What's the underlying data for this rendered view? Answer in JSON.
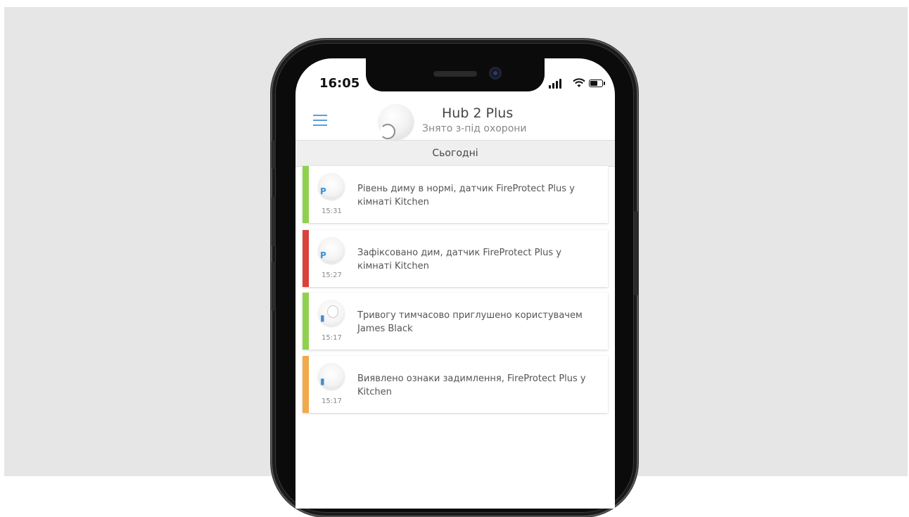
{
  "status_bar": {
    "time": "16:05"
  },
  "header": {
    "hub_name": "Hub 2 Plus",
    "hub_status": "Знято з-під охорони"
  },
  "section": {
    "title": "Сьогодні"
  },
  "events": [
    {
      "time": "15:31",
      "text": "Рівень диму в нормі, датчик FireProtect Plus у кімнаті Kitchen",
      "status_color": "#8fd14f",
      "icon": "fireprotect-detector-icon"
    },
    {
      "time": "15:27",
      "text": "Зафіксовано дим, датчик FireProtect Plus у кімнаті Kitchen",
      "status_color": "#d9423a",
      "icon": "fireprotect-detector-icon"
    },
    {
      "time": "15:17",
      "text": "Тривогу тимчасово приглушено користувачем James Black",
      "status_color": "#8fd14f",
      "icon": "user-avatar-icon"
    },
    {
      "time": "15:17",
      "text": "Виявлено ознаки задимлення, FireProtect Plus у Kitchen",
      "status_color": "#f2a94a",
      "icon": "fireprotect-detector-icon"
    }
  ]
}
